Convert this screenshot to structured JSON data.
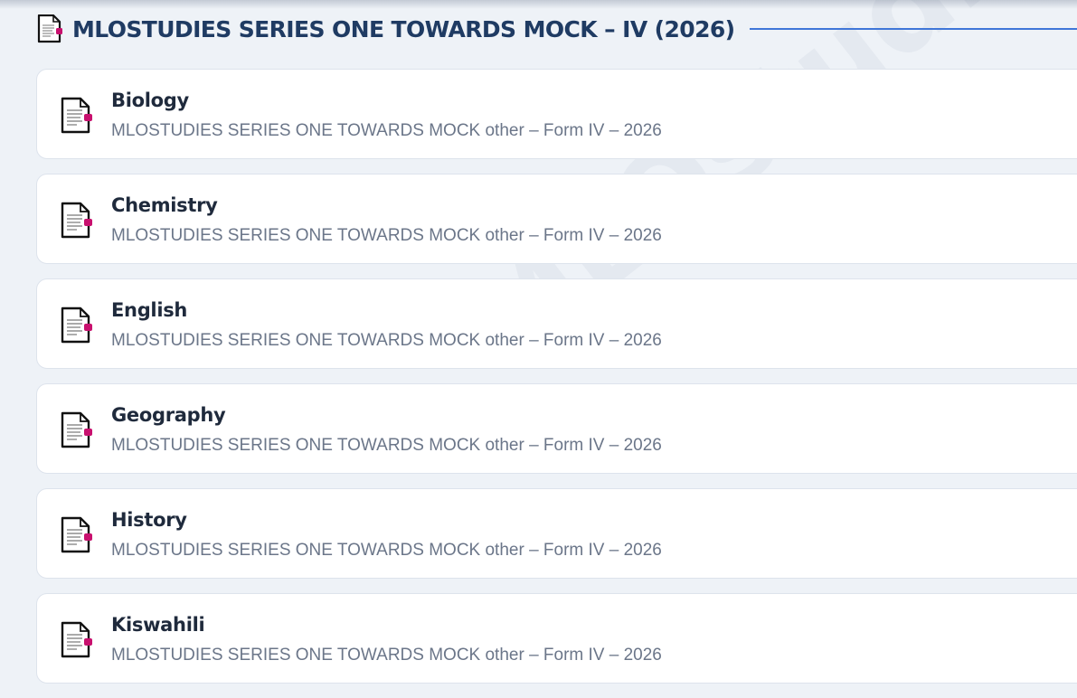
{
  "header": {
    "title": "MLOSTUDIES SERIES ONE TOWARDS MOCK – IV (2026)",
    "icon": "document-icon"
  },
  "items": [
    {
      "subject": "Biology",
      "subtitle": "MLOSTUDIES SERIES ONE TOWARDS MOCK other – Form IV – 2026",
      "icon": "document-icon"
    },
    {
      "subject": "Chemistry",
      "subtitle": "MLOSTUDIES SERIES ONE TOWARDS MOCK other – Form IV – 2026",
      "icon": "document-icon"
    },
    {
      "subject": "English",
      "subtitle": "MLOSTUDIES SERIES ONE TOWARDS MOCK other – Form IV – 2026",
      "icon": "document-icon"
    },
    {
      "subject": "Geography",
      "subtitle": "MLOSTUDIES SERIES ONE TOWARDS MOCK other – Form IV – 2026",
      "icon": "document-icon"
    },
    {
      "subject": "History",
      "subtitle": "MLOSTUDIES SERIES ONE TOWARDS MOCK other – Form IV – 2026",
      "icon": "document-icon"
    },
    {
      "subject": "Kiswahili",
      "subtitle": "MLOSTUDIES SERIES ONE TOWARDS MOCK other – Form IV – 2026",
      "icon": "document-icon"
    }
  ],
  "watermark": "MLOstudies",
  "colors": {
    "title": "#1f3b63",
    "accent_rule": "#3f76d8",
    "icon_tab": "#c8106e",
    "subject_text": "#1f2a3c",
    "subtitle_text": "#6b7689",
    "background": "#eef2f7"
  }
}
